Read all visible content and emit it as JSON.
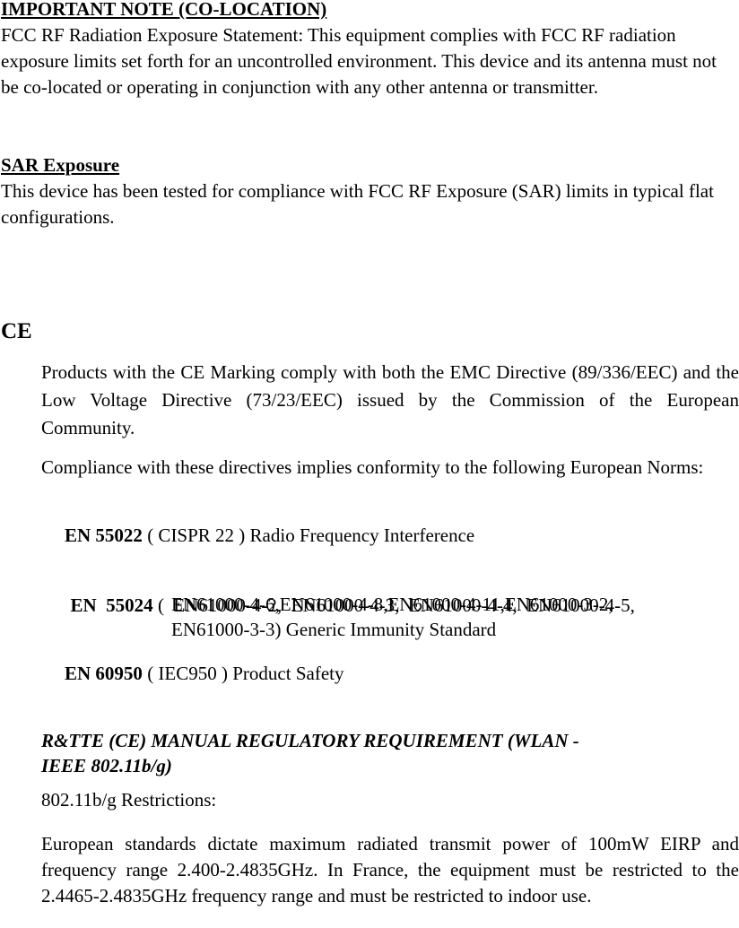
{
  "colocation": {
    "heading": "IMPORTANT NOTE (CO-LOCATION)",
    "body": "FCC RF Radiation Exposure Statement: This equipment complies with FCC RF radiation exposure limits set forth for an uncontrolled environment. This device and its antenna must not be co-located or operating in conjunction with any other antenna or transmitter."
  },
  "sar": {
    "heading": "SAR Exposure",
    "body": "This device has been tested for compliance with FCC RF Exposure (SAR) limits in typical flat configurations."
  },
  "ce": {
    "heading": "CE",
    "paragraph1": "Products with the CE Marking comply with both the EMC Directive (89/336/EEC) and the Low Voltage Directive (73/23/EEC) issued by the Commission of the European Community.",
    "paragraph2": "Compliance with these directives implies conformity to the following European Norms:",
    "norms": [
      {
        "code": "EN 55022",
        "description": " ( CISPR 22 ) Radio Frequency Interference"
      },
      {
        "code": "EN  55024",
        "description_line1": " (  EN61000-4-2,  EN61000-4-3,  EN61000-4-4,  EN61000-4-5,",
        "description_line2": "EN61000-4-6,EN61000-4-8,EN61000-4-11,EN61000-3-2,",
        "description_line3": "EN61000-3-3) Generic Immunity Standard"
      },
      {
        "code": "EN 60950",
        "description": " ( IEC950 ) Product Safety"
      }
    ]
  },
  "rtte": {
    "heading_line1": "R&TTE (CE) MANUAL REGULATORY REQUIREMENT (WLAN -",
    "heading_line2": "IEEE 802.11b/g)",
    "restrictions_label": "802.11b/g Restrictions:",
    "body": "European standards dictate maximum radiated transmit power of 100mW EIRP and frequency range 2.400-2.4835GHz. In France, the equipment must be restricted to the 2.4465-2.4835GHz frequency range and must be restricted to indoor use."
  }
}
